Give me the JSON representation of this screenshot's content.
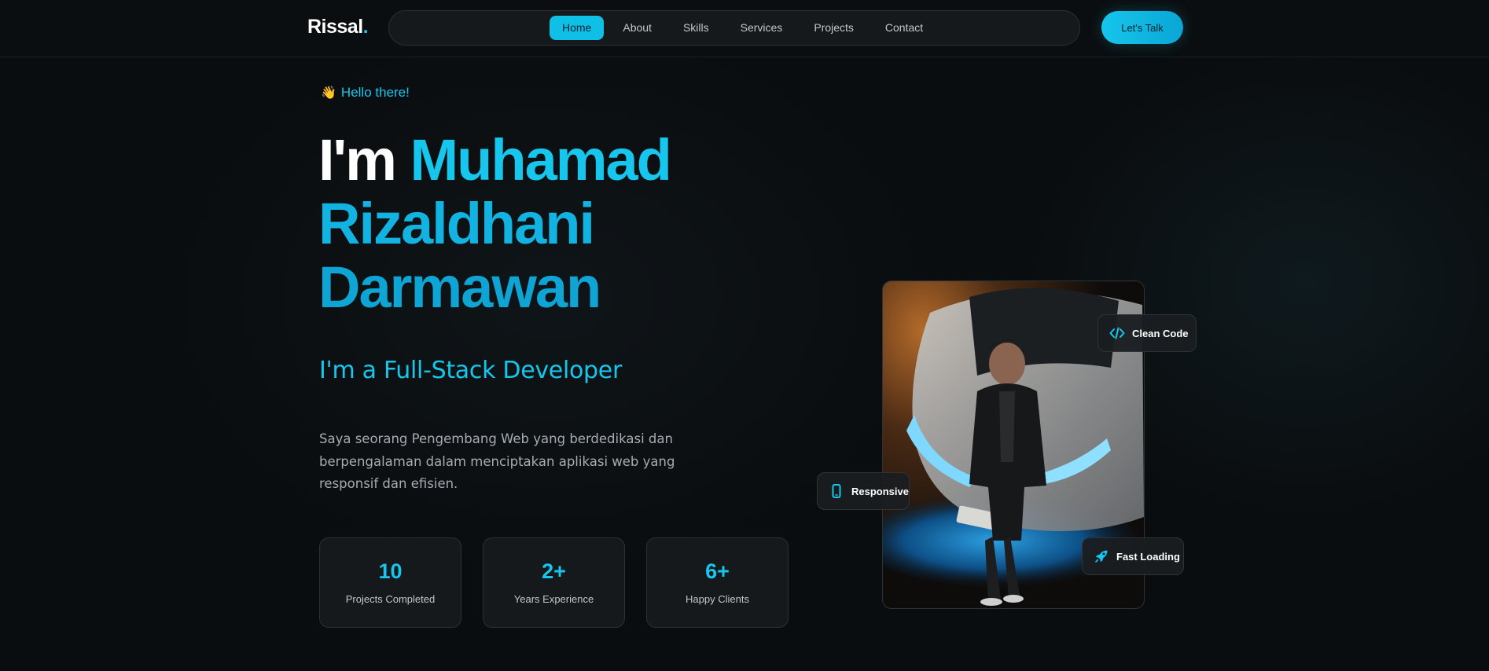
{
  "header": {
    "logo": "Rissal",
    "logo_dot": ".",
    "nav": [
      {
        "label": "Home",
        "active": true
      },
      {
        "label": "About"
      },
      {
        "label": "Skills"
      },
      {
        "label": "Services"
      },
      {
        "label": "Projects"
      },
      {
        "label": "Contact"
      }
    ],
    "cta_label": "Let's Talk"
  },
  "hero": {
    "greeting_icon": "waving-hand-icon",
    "greeting": "Hello there!",
    "title_prefix": "I'm",
    "name_line1": "Muhamad",
    "name_line2": "Rizaldhani",
    "name_line3": "Darmawan",
    "role": "I'm a Full-Stack Developer",
    "description": "Saya seorang Pengembang Web yang berdedikasi dan berpengalaman dalam menciptakan aplikasi web yang responsif dan efisien."
  },
  "stats": [
    {
      "value": "10",
      "label": "Projects Completed"
    },
    {
      "value": "2+",
      "label": "Years Experience"
    },
    {
      "value": "6+",
      "label": "Happy Clients"
    }
  ],
  "badges": {
    "clean_code": {
      "label": "Clean Code",
      "icon": "code-icon"
    },
    "responsive": {
      "label": "Responsive",
      "icon": "mobile-icon"
    },
    "fast_loading": {
      "label": "Fast Loading",
      "icon": "rocket-icon"
    }
  },
  "colors": {
    "accent": "#16c6ec",
    "background": "#0a0d0f",
    "card": "#15191b"
  }
}
